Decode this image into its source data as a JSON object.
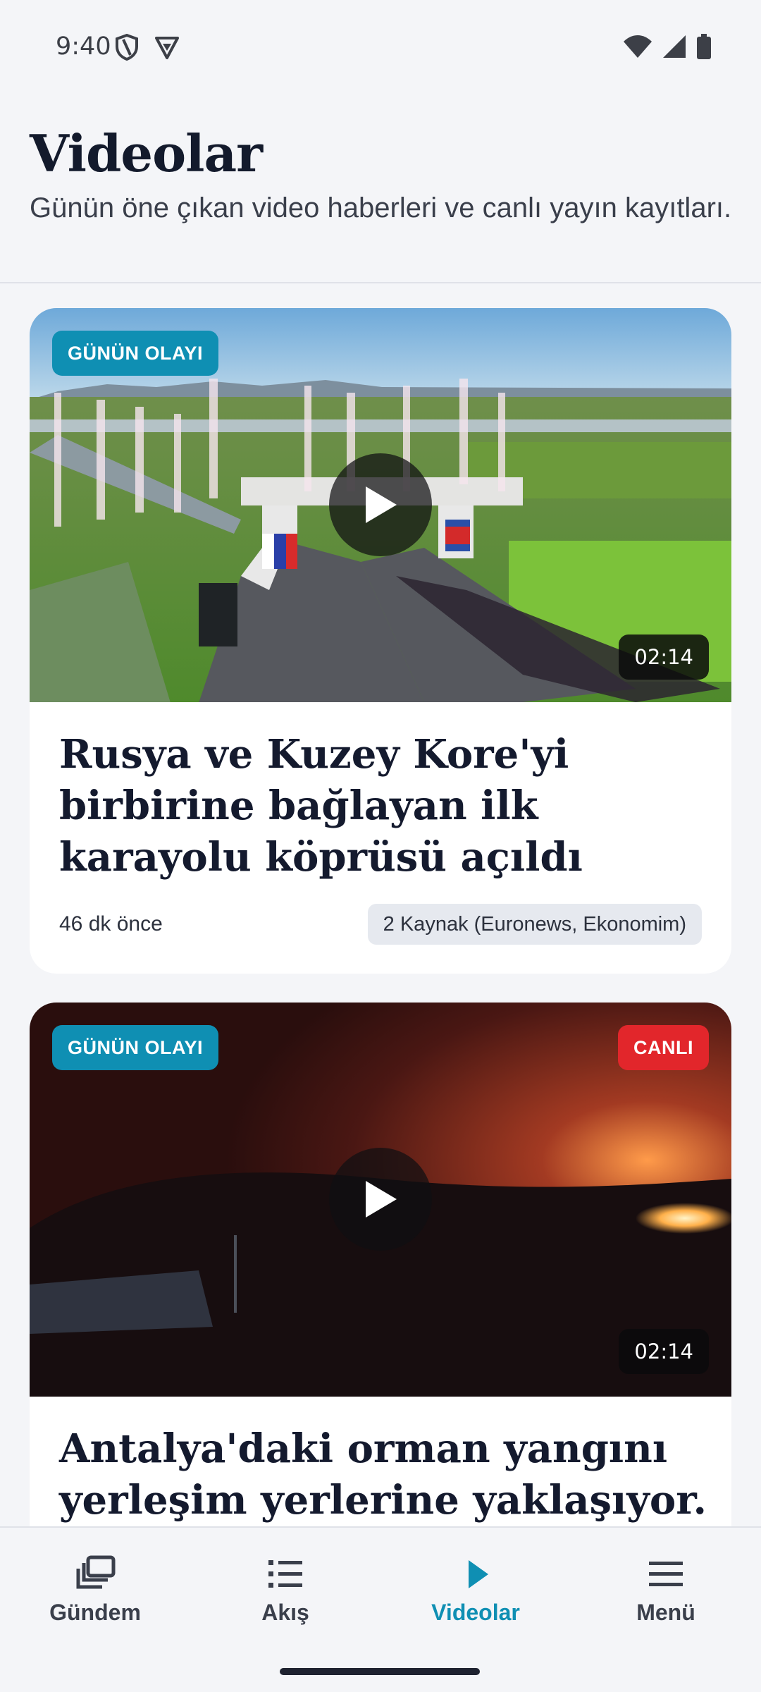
{
  "status_bar": {
    "time": "9:40"
  },
  "header": {
    "title": "Videolar",
    "subtitle": "Günün öne çıkan video haberleri ve canlı yayın kayıtları."
  },
  "cards": [
    {
      "badge": "GÜNÜN OLAYI",
      "duration": "02:14",
      "title": "Rusya ve Kuzey Kore'yi birbirine bağlayan ilk karayolu köprüsü açıldı",
      "time": "46 dk önce",
      "sources": "2 Kaynak (Euronews, Ekonomim)"
    },
    {
      "badge": "GÜNÜN OLAYI",
      "live_badge": "CANLI",
      "duration": "02:14",
      "title": "Antalya'daki orman yangını yerleşim yerlerine yaklaşıyor."
    }
  ],
  "bottom_nav": {
    "items": [
      {
        "label": "Gündem",
        "icon": "stacked-news-icon"
      },
      {
        "label": "Akış",
        "icon": "list-icon"
      },
      {
        "label": "Videolar",
        "icon": "play-icon"
      },
      {
        "label": "Menü",
        "icon": "menu-icon"
      }
    ],
    "active": "Videolar"
  },
  "colors": {
    "accent": "#0f8fb3",
    "live": "#e2262b"
  }
}
